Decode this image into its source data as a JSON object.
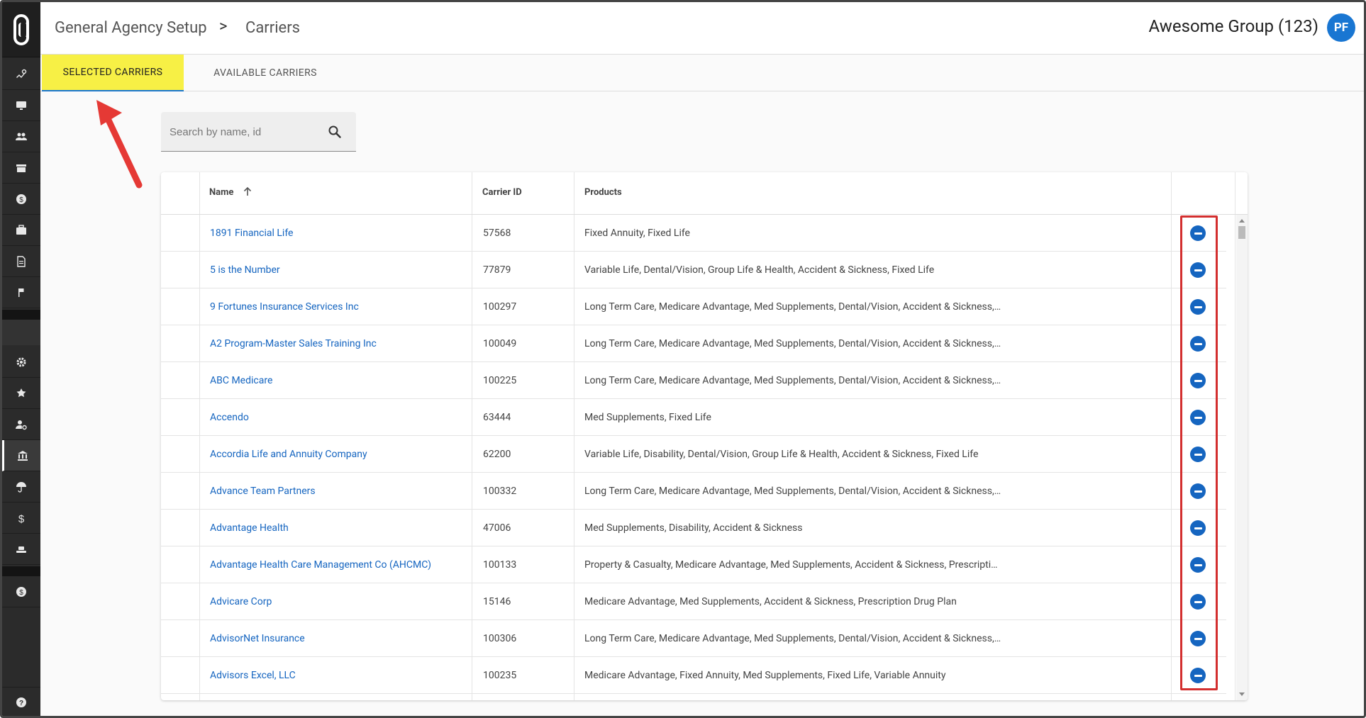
{
  "header": {
    "breadcrumb_root": "General Agency Setup",
    "breadcrumb_sep": ">",
    "breadcrumb_current": "Carriers",
    "org_name": "Awesome Group (123)",
    "avatar_initials": "PF"
  },
  "tabs": [
    {
      "label": "SELECTED CARRIERS",
      "active": true
    },
    {
      "label": "AVAILABLE CARRIERS",
      "active": false
    }
  ],
  "search": {
    "placeholder": "Search by name, id"
  },
  "table": {
    "columns": {
      "name": "Name",
      "carrier_id": "Carrier ID",
      "products": "Products"
    },
    "rows": [
      {
        "name": "1891 Financial Life",
        "id": "57568",
        "products": "Fixed Annuity, Fixed Life"
      },
      {
        "name": "5 is the Number",
        "id": "77879",
        "products": "Variable Life, Dental/Vision, Group Life & Health, Accident & Sickness, Fixed Life"
      },
      {
        "name": "9 Fortunes Insurance Services Inc",
        "id": "100297",
        "products": "Long Term Care, Medicare Advantage, Med Supplements, Dental/Vision, Accident & Sickness, Fixed Life, Prescription Drug Plan..."
      },
      {
        "name": "A2 Program-Master Sales Training Inc",
        "id": "100049",
        "products": "Long Term Care, Medicare Advantage, Med Supplements, Dental/Vision, Accident & Sickness, Fixed Life, Prescription Drug Plan..."
      },
      {
        "name": "ABC Medicare",
        "id": "100225",
        "products": "Long Term Care, Medicare Advantage, Med Supplements, Dental/Vision, Accident & Sickness, Fixed Life, Prescription Drug Plan..."
      },
      {
        "name": "Accendo",
        "id": "63444",
        "products": "Med Supplements, Fixed Life"
      },
      {
        "name": "Accordia Life and Annuity Company",
        "id": "62200",
        "products": "Variable Life, Disability, Dental/Vision, Group Life & Health, Accident & Sickness, Fixed Life"
      },
      {
        "name": "Advance Team Partners",
        "id": "100332",
        "products": "Long Term Care, Medicare Advantage, Med Supplements, Dental/Vision, Accident & Sickness, Fixed Life, Prescription Drug Plan..."
      },
      {
        "name": "Advantage Health",
        "id": "47006",
        "products": "Med Supplements, Disability, Accident & Sickness"
      },
      {
        "name": "Advantage Health Care Management Co (AHCMC)",
        "id": "100133",
        "products": "Property & Casualty, Medicare Advantage, Med Supplements, Accident & Sickness, Prescription Drug Plan"
      },
      {
        "name": "Advicare Corp",
        "id": "15146",
        "products": "Medicare Advantage, Med Supplements, Accident & Sickness, Prescription Drug Plan"
      },
      {
        "name": "AdvisorNet Insurance",
        "id": "100306",
        "products": "Long Term Care, Medicare Advantage, Med Supplements, Dental/Vision, Accident & Sickness, Fixed Life, Prescription Drug Plan..."
      },
      {
        "name": "Advisors Excel, LLC",
        "id": "100235",
        "products": "Medicare Advantage, Fixed Annuity, Med Supplements, Fixed Life, Variable Annuity"
      }
    ]
  },
  "colors": {
    "accent": "#1565c0",
    "tab_highlight": "#f7f045",
    "annotation": "#d32f2f",
    "sidebar": "#2b2b2b"
  }
}
